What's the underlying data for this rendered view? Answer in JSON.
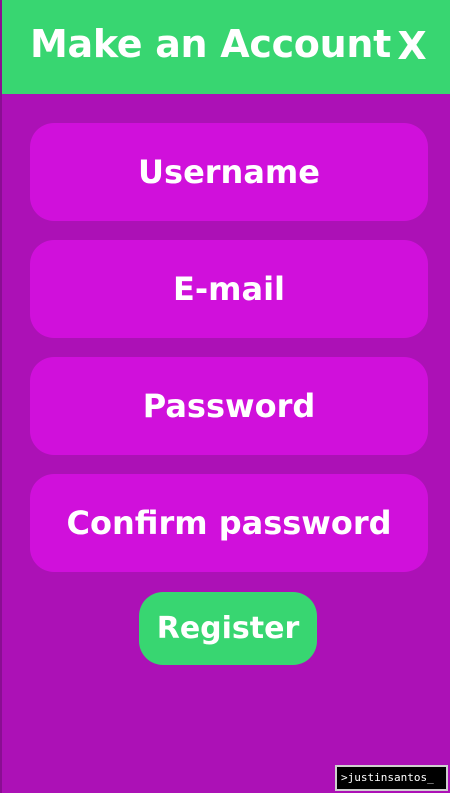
{
  "header": {
    "title": "Make an Account",
    "close_label": "X"
  },
  "form": {
    "username_placeholder": "Username",
    "email_placeholder": "E-mail",
    "password_placeholder": "Password",
    "confirm_password_placeholder": "Confirm password",
    "register_label": "Register"
  },
  "watermark": {
    "text": ">justinsantos_"
  },
  "colors": {
    "background": "#ac11b6",
    "field": "#d010db",
    "accent": "#38d671",
    "text": "#ffffff"
  }
}
